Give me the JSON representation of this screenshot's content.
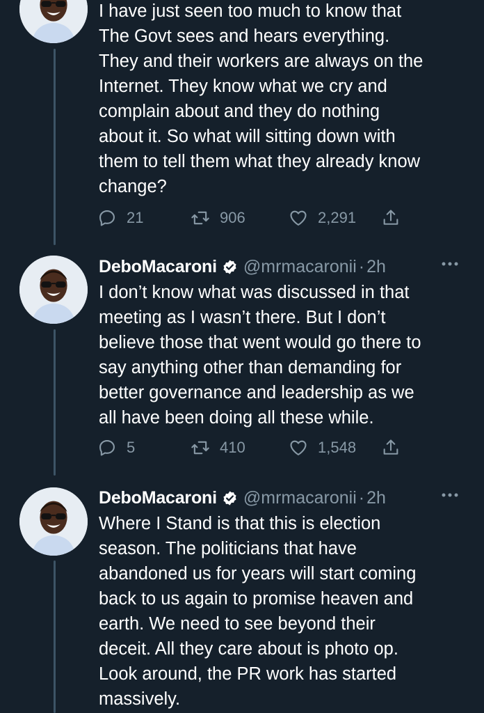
{
  "tweets": [
    {
      "display_name": "",
      "handle": "",
      "time": "",
      "text": "I have just seen too much to know that\nThe Govt sees and hears everything.\nThey and their workers are always on the\nInternet. They know what we cry and\ncomplain about and they do nothing\nabout it. So what will sitting down with\nthem to tell them what they already know\nchange?",
      "replies": "21",
      "retweets": "906",
      "likes": "2,291"
    },
    {
      "display_name": "DeboMacaroni",
      "handle": "@mrmacaronii",
      "dot": "·",
      "time": "2h",
      "text": "I don’t know what was discussed in that\nmeeting as I wasn’t there. But I don’t\nbelieve those that went would go there to\nsay anything other than demanding for\nbetter governance and leadership as we\nall have been doing all these while.",
      "replies": "5",
      "retweets": "410",
      "likes": "1,548"
    },
    {
      "display_name": "DeboMacaroni",
      "handle": "@mrmacaronii",
      "dot": "·",
      "time": "2h",
      "text": "Where I Stand is that this is election\nseason. The politicians that have\nabandoned us for years will start coming\nback to us again to promise heaven and\nearth. We need to see beyond their\ndeceit. All they care about is photo op.\nLook around, the PR work has started\nmassively."
    }
  ],
  "icons": {
    "reply": "reply-icon",
    "retweet": "retweet-icon",
    "like": "like-icon",
    "share": "share-icon",
    "verified": "verified-badge-icon",
    "more": "more-options-icon"
  },
  "colors": {
    "background": "#15202b",
    "text": "#ffffff",
    "muted": "#8899a6",
    "thread_line": "#3d5466",
    "verified_badge": "#ffffff"
  }
}
